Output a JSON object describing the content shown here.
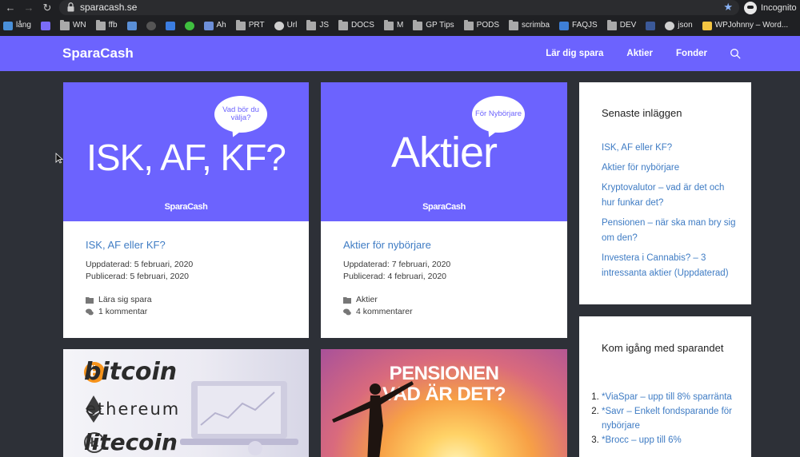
{
  "browser": {
    "url": "sparacash.se",
    "profile_label": "Incognito",
    "bookmarks": [
      {
        "label": "lång",
        "icon": "chart-icon"
      },
      {
        "label": "",
        "icon": "app-icon"
      },
      {
        "label": "WN",
        "icon": "folder-icon"
      },
      {
        "label": "ffb",
        "icon": "folder-icon"
      },
      {
        "label": "",
        "icon": "phone-icon"
      },
      {
        "label": "",
        "icon": "wordpress-icon"
      },
      {
        "label": "",
        "icon": "ad-icon"
      },
      {
        "label": "",
        "icon": "green-app-icon"
      },
      {
        "label": "Ah",
        "icon": "hand-icon"
      },
      {
        "label": "PRT",
        "icon": "folder-icon"
      },
      {
        "label": "Url",
        "icon": "globe-icon"
      },
      {
        "label": "JS",
        "icon": "folder-icon"
      },
      {
        "label": "DOCS",
        "icon": "folder-icon"
      },
      {
        "label": "M",
        "icon": "folder-icon"
      },
      {
        "label": "GP Tips",
        "icon": "folder-icon"
      },
      {
        "label": "PODS",
        "icon": "folder-icon"
      },
      {
        "label": "scrimba",
        "icon": "folder-icon"
      },
      {
        "label": "FAQJS",
        "icon": "braces-icon"
      },
      {
        "label": "DEV",
        "icon": "folder-icon"
      },
      {
        "label": "",
        "icon": "facebook-icon"
      },
      {
        "label": "json",
        "icon": "globe-icon"
      },
      {
        "label": "WPJohnny – Word...",
        "icon": "wp-johnny-icon"
      }
    ]
  },
  "site": {
    "logo": "SparaCash",
    "nav": [
      "Lär dig spara",
      "Aktier",
      "Fonder"
    ]
  },
  "posts": [
    {
      "image_title": "ISK, AF, KF?",
      "bubble": "Vad bör du välja?",
      "brand": "SparaCash",
      "title": "ISK, AF eller KF?",
      "updated": "Uppdaterad: 5 februari, 2020",
      "published": "Publicerad: 5 februari, 2020",
      "category": "Lära sig spara",
      "comments": "1 kommentar"
    },
    {
      "image_title": "Aktier",
      "bubble": "För Nybörjare",
      "brand": "SparaCash",
      "title": "Aktier för nybörjare",
      "updated": "Uppdaterad: 7 februari, 2020",
      "published": "Publicerad: 4 februari, 2020",
      "category": "Aktier",
      "comments": "4 kommentarer"
    }
  ],
  "lower_posts": [
    {
      "words": [
        "bitcoin",
        "ethereum",
        "litecoin"
      ]
    },
    {
      "text": "PENSIONEN VAD ÄR DET?"
    }
  ],
  "sidebar": {
    "recent": {
      "title": "Senaste inläggen",
      "items": [
        "ISK, AF eller KF?",
        "Aktier för nybörjare",
        "Kryptovalutor – vad är det och hur funkar det?",
        "Pensionen – när ska man bry sig om den?",
        "Investera i Cannabis? – 3 intressanta aktier (Uppdaterad)"
      ]
    },
    "start": {
      "title": "Kom igång med sparandet",
      "items": [
        "*ViaSpar – upp till 8% sparränta",
        "*Savr – Enkelt fondsparande för nybörjare",
        "*Brocc – upp till 6%"
      ]
    }
  },
  "colors": {
    "brand": "#6c63fe",
    "link": "#3f7cc4",
    "background": "#2d3037"
  }
}
